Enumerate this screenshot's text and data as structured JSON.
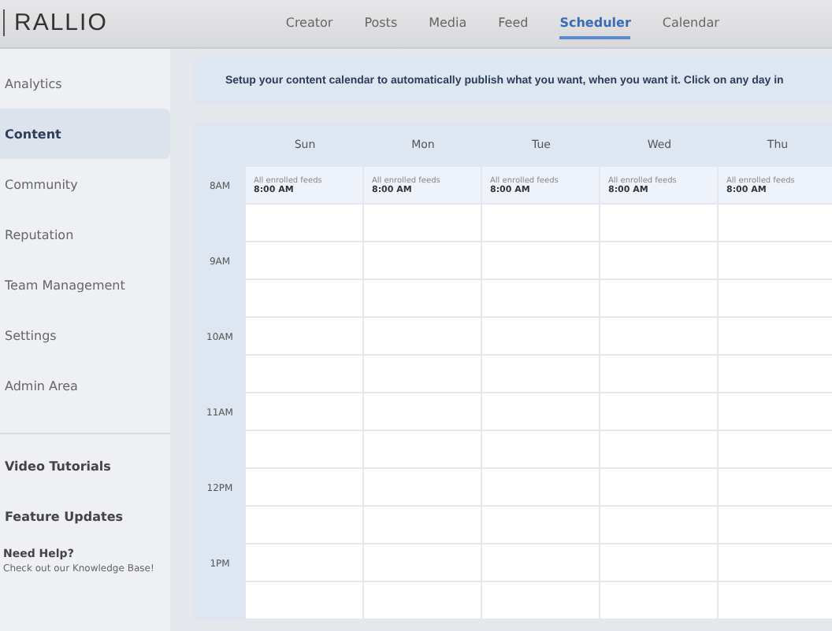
{
  "header": {
    "logo": "RALLIO",
    "tabs": [
      {
        "label": "Creator",
        "selected": false
      },
      {
        "label": "Posts",
        "selected": false
      },
      {
        "label": "Media",
        "selected": false
      },
      {
        "label": "Feed",
        "selected": false
      },
      {
        "label": "Scheduler",
        "selected": true
      },
      {
        "label": "Calendar",
        "selected": false
      }
    ]
  },
  "sidebar": {
    "items": [
      {
        "label": "Analytics",
        "selected": false
      },
      {
        "label": "Content",
        "selected": true
      },
      {
        "label": "Community",
        "selected": false
      },
      {
        "label": "Reputation",
        "selected": false
      },
      {
        "label": "Team Management",
        "selected": false
      },
      {
        "label": "Settings",
        "selected": false
      },
      {
        "label": "Admin Area",
        "selected": false
      }
    ],
    "links": [
      "Video Tutorials",
      "Feature Updates"
    ],
    "help": {
      "title": "Need Help?",
      "text": "Check out our Knowledge Base!"
    }
  },
  "banner": "Setup your content calendar to automatically publish what you want, when you want it. Click on any day in",
  "calendar": {
    "days": [
      "Sun",
      "Mon",
      "Tue",
      "Wed",
      "Thu"
    ],
    "hours": [
      {
        "label": "8AM",
        "events": [
          {
            "feeds": "All enrolled feeds",
            "time": "8:00 AM"
          },
          {
            "feeds": "All enrolled feeds",
            "time": "8:00 AM"
          },
          {
            "feeds": "All enrolled feeds",
            "time": "8:00 AM"
          },
          {
            "feeds": "All enrolled feeds",
            "time": "8:00 AM"
          },
          {
            "feeds": "All enrolled feeds",
            "time": "8:00 AM"
          }
        ]
      },
      {
        "label": "9AM"
      },
      {
        "label": "10AM"
      },
      {
        "label": "11AM"
      },
      {
        "label": "12PM"
      },
      {
        "label": "1PM"
      }
    ]
  }
}
